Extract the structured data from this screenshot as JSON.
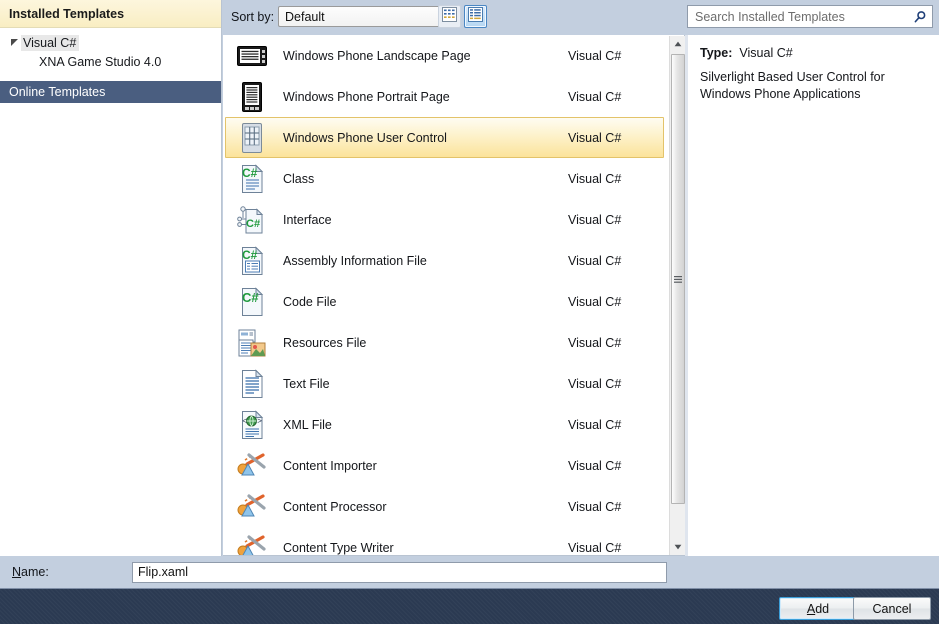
{
  "sidebar": {
    "header": "Installed Templates",
    "tree": {
      "root_label": "Visual C#",
      "child_label": "XNA Game Studio 4.0"
    },
    "online_templates": "Online Templates"
  },
  "toolbar": {
    "sort_by_label": "Sort by:",
    "sort_by_value": "Default",
    "view_small_icons": "small-icons-view",
    "view_large_icons": "large-icons-view"
  },
  "search": {
    "placeholder": "Search Installed Templates",
    "value": ""
  },
  "templates": {
    "rows": [
      {
        "name": "Windows Phone Landscape Page",
        "lang": "Visual C#",
        "icon": "phone-landscape-icon",
        "selected": false
      },
      {
        "name": "Windows Phone Portrait Page",
        "lang": "Visual C#",
        "icon": "phone-portrait-icon",
        "selected": false
      },
      {
        "name": "Windows Phone User Control",
        "lang": "Visual C#",
        "icon": "phone-user-control-icon",
        "selected": true
      },
      {
        "name": "Class",
        "lang": "Visual C#",
        "icon": "csharp-class-icon",
        "selected": false
      },
      {
        "name": "Interface",
        "lang": "Visual C#",
        "icon": "csharp-interface-icon",
        "selected": false
      },
      {
        "name": "Assembly Information File",
        "lang": "Visual C#",
        "icon": "csharp-assembly-info-icon",
        "selected": false
      },
      {
        "name": "Code File",
        "lang": "Visual C#",
        "icon": "csharp-code-file-icon",
        "selected": false
      },
      {
        "name": "Resources File",
        "lang": "Visual C#",
        "icon": "resources-file-icon",
        "selected": false
      },
      {
        "name": "Text File",
        "lang": "Visual C#",
        "icon": "text-file-icon",
        "selected": false
      },
      {
        "name": "XML File",
        "lang": "Visual C#",
        "icon": "xml-file-icon",
        "selected": false
      },
      {
        "name": "Content Importer",
        "lang": "Visual C#",
        "icon": "content-pipeline-icon",
        "selected": false
      },
      {
        "name": "Content Processor",
        "lang": "Visual C#",
        "icon": "content-pipeline-icon",
        "selected": false
      },
      {
        "name": "Content Type Writer",
        "lang": "Visual C#",
        "icon": "content-pipeline-icon",
        "selected": false
      }
    ]
  },
  "info": {
    "type_label": "Type:",
    "type_value": "Visual C#",
    "description": "Silverlight Based User Control for Windows Phone Applications"
  },
  "name_field": {
    "label_prefix": "",
    "label_accel": "N",
    "label_rest": "ame:",
    "value": "Flip.xaml"
  },
  "buttons": {
    "add_accel": "A",
    "add_rest": "dd",
    "cancel": "Cancel"
  },
  "colors": {
    "header_cream": "#f9eec3",
    "selected_band": "#4a5e80",
    "row_selected_border": "#e3c36a",
    "dialog_chrome": "#c3cfdf",
    "footer": "#2b3a52",
    "focus_blue": "#3c9fd9"
  }
}
